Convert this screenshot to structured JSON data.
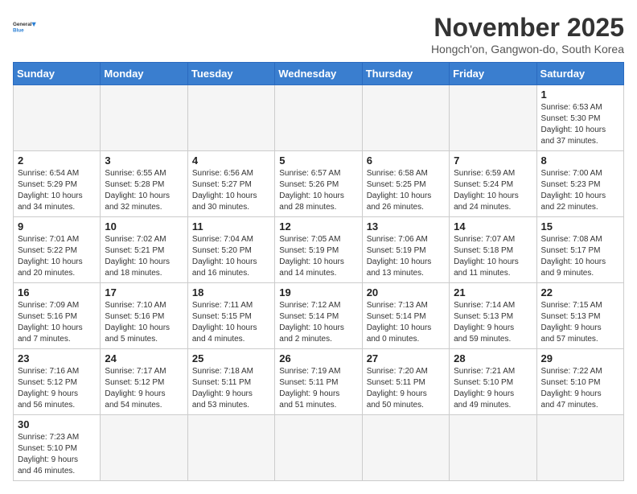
{
  "header": {
    "logo_general": "General",
    "logo_blue": "Blue",
    "month_title": "November 2025",
    "subtitle": "Hongch'on, Gangwon-do, South Korea"
  },
  "weekdays": [
    "Sunday",
    "Monday",
    "Tuesday",
    "Wednesday",
    "Thursday",
    "Friday",
    "Saturday"
  ],
  "weeks": [
    [
      {
        "day": "",
        "info": ""
      },
      {
        "day": "",
        "info": ""
      },
      {
        "day": "",
        "info": ""
      },
      {
        "day": "",
        "info": ""
      },
      {
        "day": "",
        "info": ""
      },
      {
        "day": "",
        "info": ""
      },
      {
        "day": "1",
        "info": "Sunrise: 6:53 AM\nSunset: 5:30 PM\nDaylight: 10 hours\nand 37 minutes."
      }
    ],
    [
      {
        "day": "2",
        "info": "Sunrise: 6:54 AM\nSunset: 5:29 PM\nDaylight: 10 hours\nand 34 minutes."
      },
      {
        "day": "3",
        "info": "Sunrise: 6:55 AM\nSunset: 5:28 PM\nDaylight: 10 hours\nand 32 minutes."
      },
      {
        "day": "4",
        "info": "Sunrise: 6:56 AM\nSunset: 5:27 PM\nDaylight: 10 hours\nand 30 minutes."
      },
      {
        "day": "5",
        "info": "Sunrise: 6:57 AM\nSunset: 5:26 PM\nDaylight: 10 hours\nand 28 minutes."
      },
      {
        "day": "6",
        "info": "Sunrise: 6:58 AM\nSunset: 5:25 PM\nDaylight: 10 hours\nand 26 minutes."
      },
      {
        "day": "7",
        "info": "Sunrise: 6:59 AM\nSunset: 5:24 PM\nDaylight: 10 hours\nand 24 minutes."
      },
      {
        "day": "8",
        "info": "Sunrise: 7:00 AM\nSunset: 5:23 PM\nDaylight: 10 hours\nand 22 minutes."
      }
    ],
    [
      {
        "day": "9",
        "info": "Sunrise: 7:01 AM\nSunset: 5:22 PM\nDaylight: 10 hours\nand 20 minutes."
      },
      {
        "day": "10",
        "info": "Sunrise: 7:02 AM\nSunset: 5:21 PM\nDaylight: 10 hours\nand 18 minutes."
      },
      {
        "day": "11",
        "info": "Sunrise: 7:04 AM\nSunset: 5:20 PM\nDaylight: 10 hours\nand 16 minutes."
      },
      {
        "day": "12",
        "info": "Sunrise: 7:05 AM\nSunset: 5:19 PM\nDaylight: 10 hours\nand 14 minutes."
      },
      {
        "day": "13",
        "info": "Sunrise: 7:06 AM\nSunset: 5:19 PM\nDaylight: 10 hours\nand 13 minutes."
      },
      {
        "day": "14",
        "info": "Sunrise: 7:07 AM\nSunset: 5:18 PM\nDaylight: 10 hours\nand 11 minutes."
      },
      {
        "day": "15",
        "info": "Sunrise: 7:08 AM\nSunset: 5:17 PM\nDaylight: 10 hours\nand 9 minutes."
      }
    ],
    [
      {
        "day": "16",
        "info": "Sunrise: 7:09 AM\nSunset: 5:16 PM\nDaylight: 10 hours\nand 7 minutes."
      },
      {
        "day": "17",
        "info": "Sunrise: 7:10 AM\nSunset: 5:16 PM\nDaylight: 10 hours\nand 5 minutes."
      },
      {
        "day": "18",
        "info": "Sunrise: 7:11 AM\nSunset: 5:15 PM\nDaylight: 10 hours\nand 4 minutes."
      },
      {
        "day": "19",
        "info": "Sunrise: 7:12 AM\nSunset: 5:14 PM\nDaylight: 10 hours\nand 2 minutes."
      },
      {
        "day": "20",
        "info": "Sunrise: 7:13 AM\nSunset: 5:14 PM\nDaylight: 10 hours\nand 0 minutes."
      },
      {
        "day": "21",
        "info": "Sunrise: 7:14 AM\nSunset: 5:13 PM\nDaylight: 9 hours\nand 59 minutes."
      },
      {
        "day": "22",
        "info": "Sunrise: 7:15 AM\nSunset: 5:13 PM\nDaylight: 9 hours\nand 57 minutes."
      }
    ],
    [
      {
        "day": "23",
        "info": "Sunrise: 7:16 AM\nSunset: 5:12 PM\nDaylight: 9 hours\nand 56 minutes."
      },
      {
        "day": "24",
        "info": "Sunrise: 7:17 AM\nSunset: 5:12 PM\nDaylight: 9 hours\nand 54 minutes."
      },
      {
        "day": "25",
        "info": "Sunrise: 7:18 AM\nSunset: 5:11 PM\nDaylight: 9 hours\nand 53 minutes."
      },
      {
        "day": "26",
        "info": "Sunrise: 7:19 AM\nSunset: 5:11 PM\nDaylight: 9 hours\nand 51 minutes."
      },
      {
        "day": "27",
        "info": "Sunrise: 7:20 AM\nSunset: 5:11 PM\nDaylight: 9 hours\nand 50 minutes."
      },
      {
        "day": "28",
        "info": "Sunrise: 7:21 AM\nSunset: 5:10 PM\nDaylight: 9 hours\nand 49 minutes."
      },
      {
        "day": "29",
        "info": "Sunrise: 7:22 AM\nSunset: 5:10 PM\nDaylight: 9 hours\nand 47 minutes."
      }
    ],
    [
      {
        "day": "30",
        "info": "Sunrise: 7:23 AM\nSunset: 5:10 PM\nDaylight: 9 hours\nand 46 minutes."
      },
      {
        "day": "",
        "info": ""
      },
      {
        "day": "",
        "info": ""
      },
      {
        "day": "",
        "info": ""
      },
      {
        "day": "",
        "info": ""
      },
      {
        "day": "",
        "info": ""
      },
      {
        "day": "",
        "info": ""
      }
    ]
  ]
}
